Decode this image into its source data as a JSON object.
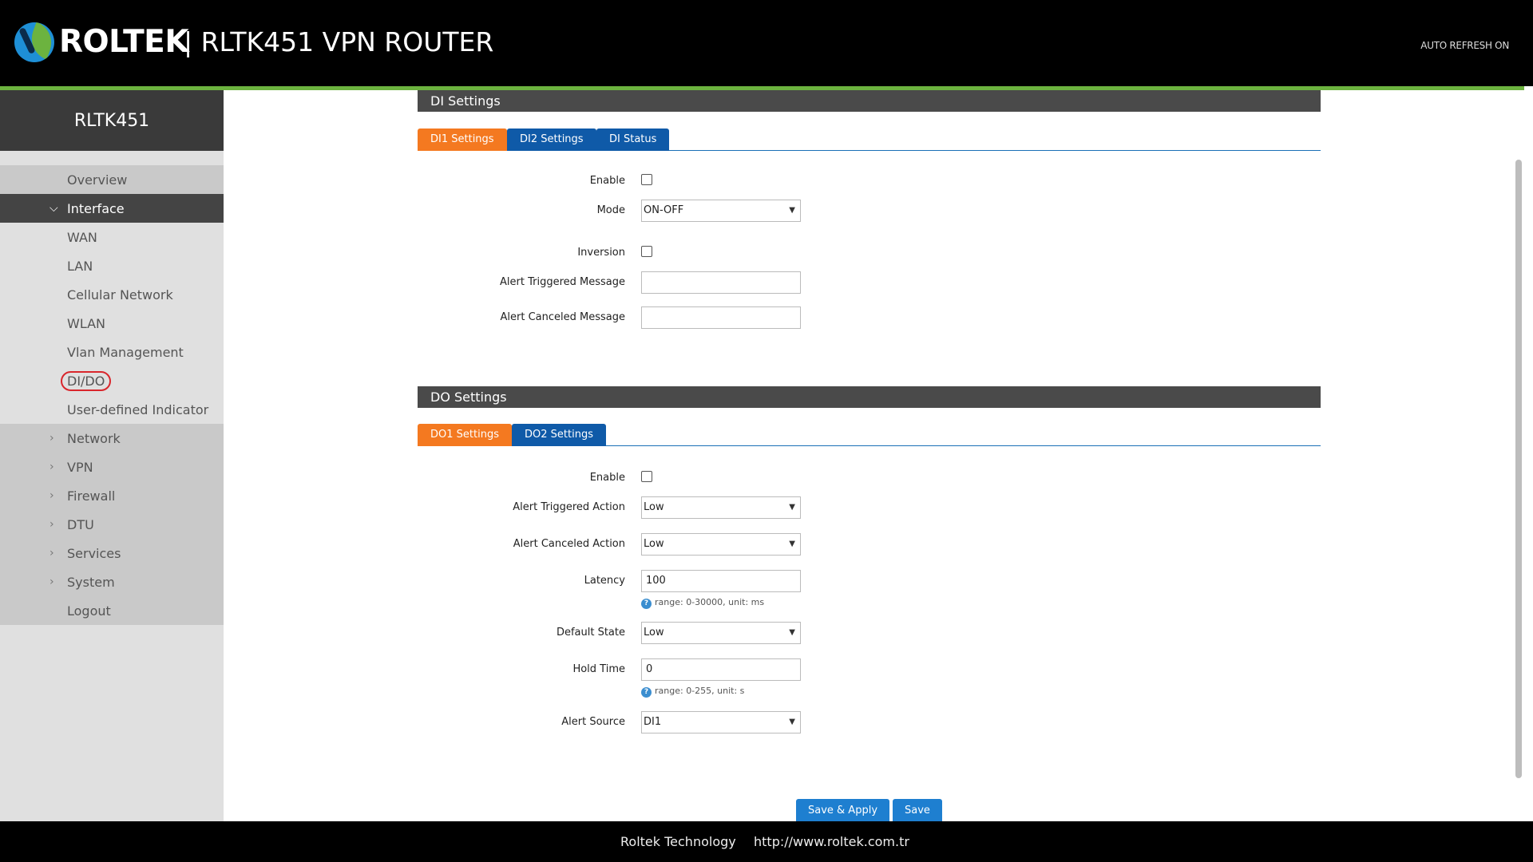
{
  "header": {
    "brand": "ROLTEK",
    "product": "| RLTK451 VPN ROUTER",
    "auto_refresh": "AUTO REFRESH ON"
  },
  "sidebar": {
    "device": "RLTK451",
    "items": [
      {
        "label": "Overview"
      },
      {
        "label": "Interface"
      },
      {
        "label": "WAN"
      },
      {
        "label": "LAN"
      },
      {
        "label": "Cellular Network"
      },
      {
        "label": "WLAN"
      },
      {
        "label": "Vlan Management"
      },
      {
        "label": "DI/DO"
      },
      {
        "label": "User-defined Indicator"
      },
      {
        "label": "Network"
      },
      {
        "label": "VPN"
      },
      {
        "label": "Firewall"
      },
      {
        "label": "DTU"
      },
      {
        "label": "Services"
      },
      {
        "label": "System"
      },
      {
        "label": "Logout"
      }
    ]
  },
  "di": {
    "title": "DI Settings",
    "tabs": [
      "DI1 Settings",
      "DI2 Settings",
      "DI Status"
    ],
    "enable_label": "Enable",
    "mode_label": "Mode",
    "mode_value": "ON-OFF",
    "inversion_label": "Inversion",
    "alert_triggered_msg_label": "Alert Triggered Message",
    "alert_triggered_msg_value": "",
    "alert_canceled_msg_label": "Alert Canceled Message",
    "alert_canceled_msg_value": ""
  },
  "do": {
    "title": "DO Settings",
    "tabs": [
      "DO1 Settings",
      "DO2 Settings"
    ],
    "enable_label": "Enable",
    "alert_triggered_action_label": "Alert Triggered Action",
    "alert_triggered_action_value": "Low",
    "alert_canceled_action_label": "Alert Canceled Action",
    "alert_canceled_action_value": "Low",
    "latency_label": "Latency",
    "latency_value": "100",
    "latency_hint": "range: 0-30000, unit: ms",
    "default_state_label": "Default State",
    "default_state_value": "Low",
    "hold_time_label": "Hold Time",
    "hold_time_value": "0",
    "hold_time_hint": "range: 0-255, unit: s",
    "alert_source_label": "Alert Source",
    "alert_source_value": "DI1"
  },
  "actions": {
    "save_apply": "Save & Apply",
    "save": "Save"
  },
  "footer": {
    "company": "Roltek Technology",
    "url": "http://www.roltek.com.tr"
  },
  "colors": {
    "accent_green": "#6cb33f",
    "tab_active": "#f47920",
    "tab_inactive": "#0f5aa8",
    "button": "#1e7fd0"
  }
}
